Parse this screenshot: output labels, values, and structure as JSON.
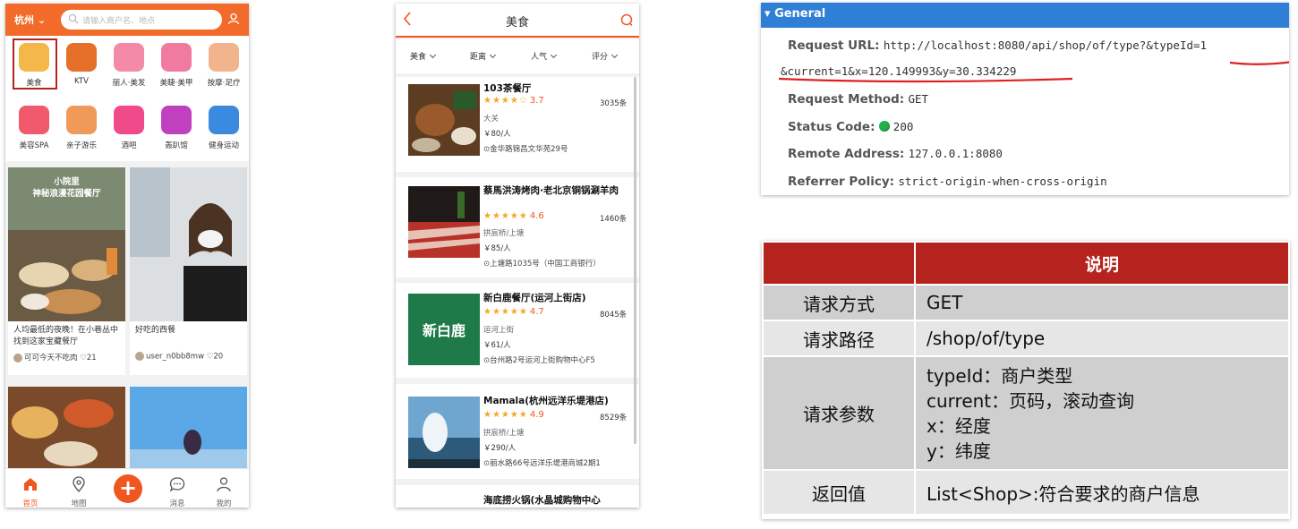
{
  "phone1": {
    "city": "杭州",
    "search_placeholder": "请输入商户名、地点",
    "categories": [
      "美食",
      "KTV",
      "丽人·美发",
      "美睫·美甲",
      "按摩·足疗",
      "美容SPA",
      "亲子游乐",
      "酒吧",
      "轰趴馆",
      "健身运动"
    ],
    "cards": [
      {
        "overlay": "小院里\n神秘浪漫花园餐厅",
        "title": "人均最低的夜晚！在小巷丛中找到这家宝藏餐厅",
        "user": "可可今天不吃肉",
        "likes": "21"
      },
      {
        "overlay": "",
        "title": "好吃的西餐",
        "user": "user_n0bb8mw",
        "likes": "20"
      }
    ],
    "tabs": [
      "首页",
      "地图",
      "消息",
      "我的"
    ],
    "plus": "+",
    "colors": {
      "brand": "#f26b2a",
      "active_tab": "#f0561f"
    }
  },
  "phone2": {
    "title": "美食",
    "filters": [
      "美食",
      "距离",
      "人气",
      "评分"
    ],
    "shops": [
      {
        "name": "103茶餐厅",
        "stars": "★★★★☆",
        "score": "3.7",
        "comments": "3035条",
        "area": "大关",
        "price": "￥80/人",
        "address": "金华路锦昌文华苑29号"
      },
      {
        "name": "蔡馬洪涛烤肉·老北京铜锅涮羊肉",
        "stars": "★★★★★",
        "score": "4.6",
        "comments": "1460条",
        "area": "拱宸桥/上塘",
        "price": "￥85/人",
        "address": "上塘路1035号（中国工商银行）"
      },
      {
        "name": "新白鹿餐厅(运河上街店)",
        "stars": "★★★★★",
        "score": "4.7",
        "comments": "8045条",
        "area": "运河上街",
        "price": "￥61/人",
        "address": "台州路2号运河上街购物中心F5"
      },
      {
        "name": "Mamala(杭州远洋乐堤港店)",
        "stars": "★★★★★",
        "score": "4.9",
        "comments": "8529条",
        "area": "拱宸桥/上塘",
        "price": "￥290/人",
        "address": "丽水路66号远洋乐堤港商城2期1"
      },
      {
        "name": "海底捞火锅(水晶城购物中心",
        "stars": "",
        "score": "",
        "comments": "",
        "area": "",
        "price": "",
        "address": ""
      }
    ],
    "logo_text": "新白鹿"
  },
  "devtools": {
    "section": "General",
    "request_url_label": "Request URL:",
    "request_url_line1": "http://localhost:8080/api/shop/of/type?&typeId=1",
    "request_url_line2": "&current=1&x=120.149993&y=30.334229",
    "method_label": "Request Method:",
    "method": "GET",
    "status_label": "Status Code:",
    "status": "200",
    "remote_label": "Remote Address:",
    "remote": "127.0.0.1:8080",
    "referrer_label": "Referrer Policy:",
    "referrer": "strict-origin-when-cross-origin",
    "underline_color": "#e02020"
  },
  "spec_table": {
    "header": [
      "",
      "说明"
    ],
    "rows": [
      {
        "key": "请求方式",
        "lines": [
          "GET"
        ]
      },
      {
        "key": "请求路径",
        "lines": [
          "/shop/of/type"
        ]
      },
      {
        "key": "请求参数",
        "lines": [
          "typeId：商户类型",
          "current：页码，滚动查询",
          "x：经度",
          "y：纬度"
        ]
      },
      {
        "key": "返回值",
        "lines": [
          "List<Shop>:符合要求的商户信息"
        ]
      }
    ],
    "header_color": "#b5231f"
  }
}
